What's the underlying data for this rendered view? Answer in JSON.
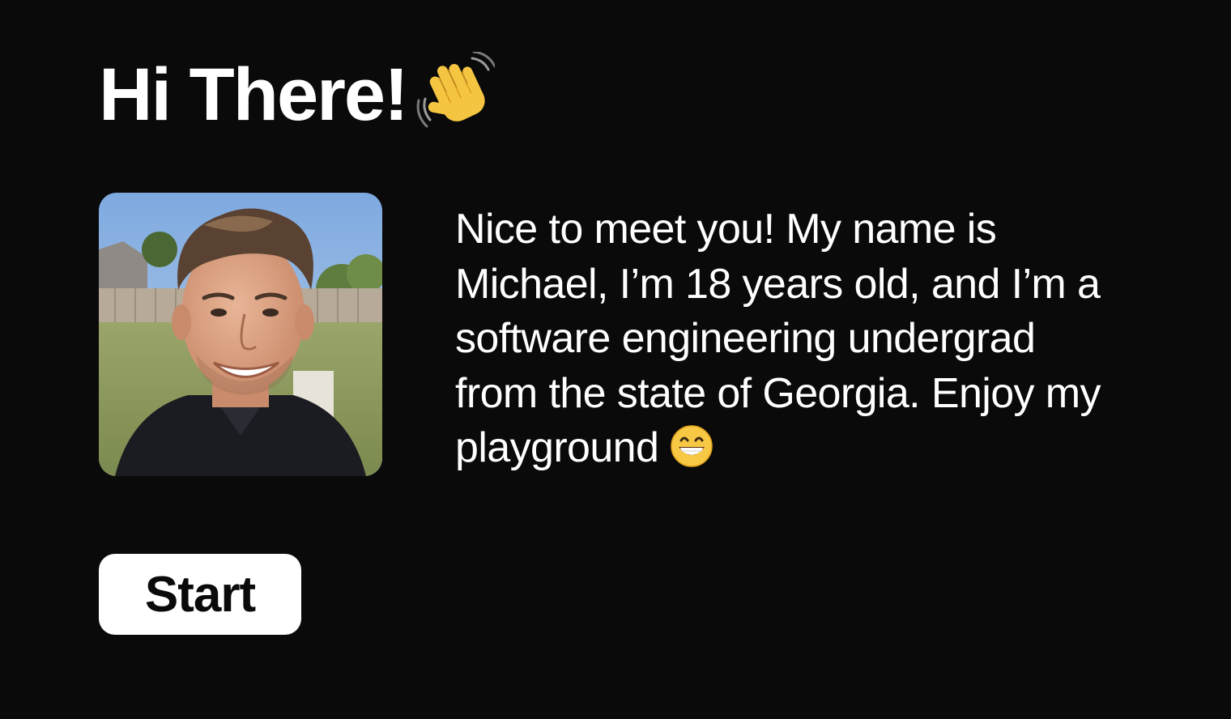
{
  "header": {
    "title": "Hi There!",
    "title_emoji": "waving-hand-icon"
  },
  "profile": {
    "photo": "profile-photo"
  },
  "bio": {
    "lines": [
      "Nice to meet you! My name is",
      "Michael, I’m 18 years old, and I’m a",
      "software engineering undergrad",
      "from the state of Georgia. Enjoy my",
      "playground"
    ],
    "trailing_emoji": "grinning-face-icon"
  },
  "actions": {
    "start_label": "Start"
  },
  "colors": {
    "background": "#0a0a0a",
    "text": "#ffffff",
    "button_bg": "#ffffff",
    "button_text": "#0a0a0a"
  }
}
